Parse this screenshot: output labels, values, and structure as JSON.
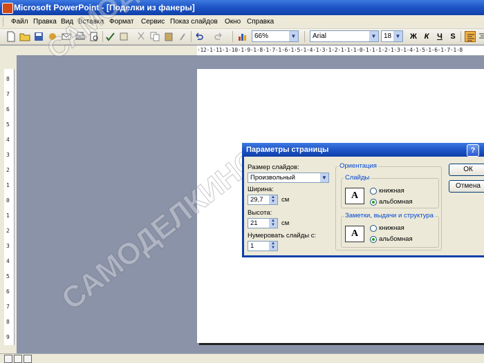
{
  "window": {
    "title": "Microsoft PowerPoint - [Поделки из фанеры]"
  },
  "menu": [
    "Файл",
    "Правка",
    "Вид",
    "Вставка",
    "Формат",
    "Сервис",
    "Показ слайдов",
    "Окно",
    "Справка"
  ],
  "toolbar": {
    "zoom": "66%",
    "font": "Arial",
    "size": "18",
    "bold": "Ж",
    "italic": "К",
    "underline": "Ч",
    "shadow": "S"
  },
  "ruler": {
    "horizontal": "·12·1·11·1·10·1·9·1·8·1·7·1·6·1·5·1·4·1·3·1·2·1·1·1·0·1·1·1·2·1·3·1·4·1·5·1·6·1·7·1·8",
    "vertical": [
      "8",
      "7",
      "6",
      "5",
      "4",
      "3",
      "2",
      "1",
      "0",
      "1",
      "2",
      "3",
      "4",
      "5",
      "6",
      "7",
      "8",
      "9"
    ]
  },
  "watermark": "САМОДЕЛКИНО",
  "dialog": {
    "title": "Параметры страницы",
    "help": "?",
    "slide_size_label": "Размер слайдов:",
    "slide_size_value": "Произвольный",
    "width_label": "Ширина:",
    "width_value": "29,7",
    "height_label": "Высота:",
    "height_value": "21",
    "unit": "см",
    "numbering_label": "Нумеровать слайды с:",
    "numbering_value": "1",
    "orientation_label": "Ориентация",
    "slides_group": "Слайды",
    "notes_group": "Заметки, выдачи и структура",
    "portrait": "книжная",
    "landscape": "альбомная",
    "ok": "ОК",
    "cancel": "Отмена"
  },
  "colors": {
    "title_bar": "#1f56c8",
    "group_title": "#0046d5",
    "radio_on": "#21a121"
  }
}
